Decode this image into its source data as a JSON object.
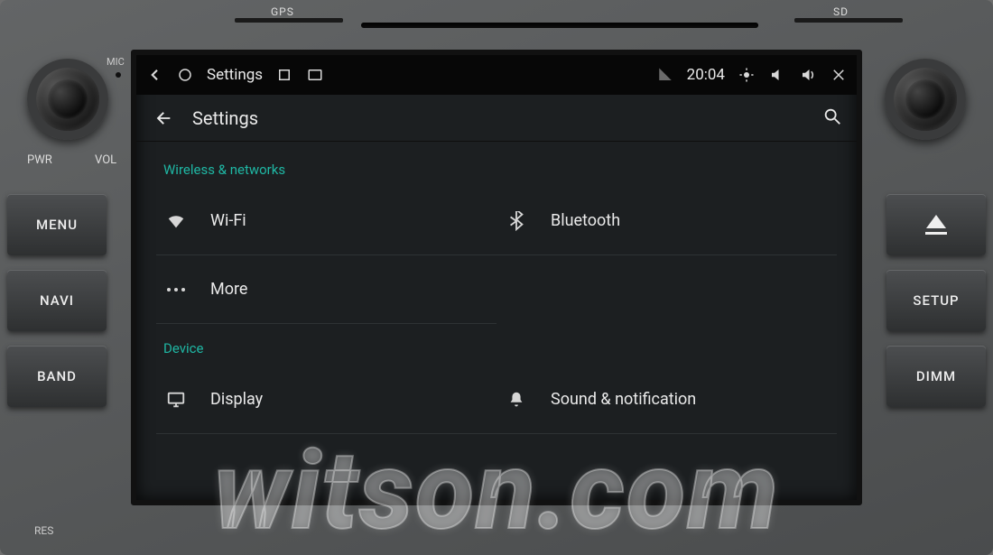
{
  "hardware": {
    "slot_labels": {
      "gps": "GPS",
      "sd": "SD"
    },
    "mic_label": "MIC",
    "dial_labels": {
      "pwr": "PWR",
      "vol": "VOL",
      "res": "RES"
    },
    "left_buttons": [
      "MENU",
      "NAVI",
      "BAND"
    ],
    "right_buttons": {
      "setup": "SETUP",
      "dimm": "DIMM"
    }
  },
  "sysbar": {
    "title": "Settings",
    "clock": "20:04"
  },
  "settings_header": {
    "title": "Settings"
  },
  "sections": {
    "wireless": {
      "label": "Wireless & networks",
      "items": {
        "wifi": "Wi-Fi",
        "bluetooth": "Bluetooth",
        "more": "More"
      }
    },
    "device": {
      "label": "Device",
      "items": {
        "display": "Display",
        "sound": "Sound & notification"
      }
    }
  },
  "watermark": "witson.com"
}
